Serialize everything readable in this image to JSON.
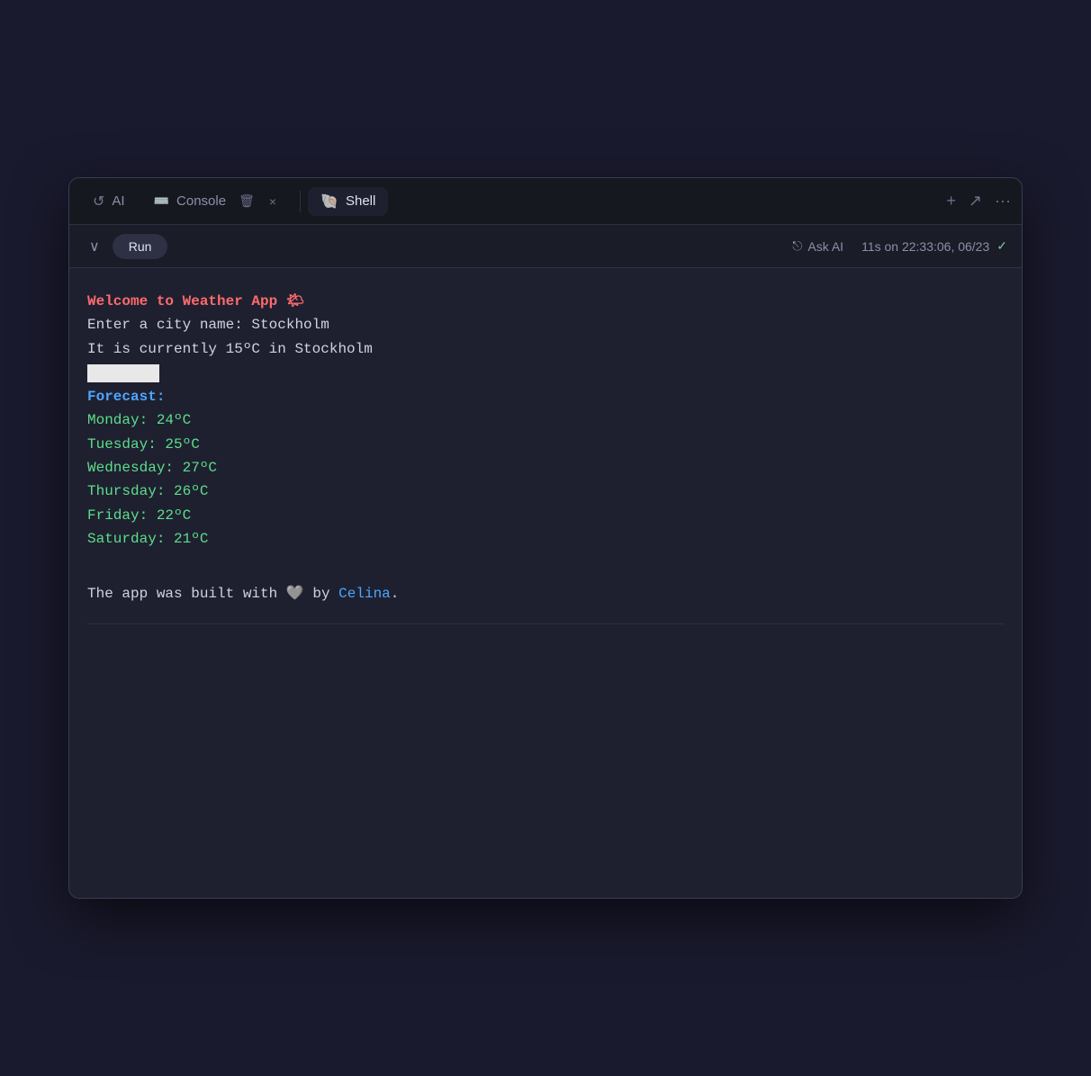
{
  "tabs": [
    {
      "id": "ai",
      "icon": "↺",
      "label": "AI",
      "active": false
    },
    {
      "id": "console",
      "icon": ">_",
      "label": "Console",
      "active": false
    },
    {
      "id": "shell",
      "icon": "🐚",
      "label": "Shell",
      "active": true
    }
  ],
  "tab_actions": {
    "trash": "🗑",
    "close": "×"
  },
  "tab_bar_right": {
    "add": "+",
    "expand": "↗",
    "more": "···"
  },
  "toolbar": {
    "chevron": "∨",
    "run_label": "Run",
    "ask_ai_icon": "⎋",
    "ask_ai_label": "Ask AI",
    "timestamp": "11s on 22:33:06, 06/23",
    "checkmark": "✓"
  },
  "terminal": {
    "welcome": "Welcome to Weather App 🌤",
    "city_prompt": "Enter a city name: Stockholm",
    "current_temp": "It is currently 15ºC in Stockholm",
    "forecast_label": "Forecast:",
    "forecast": [
      {
        "day": "Monday:",
        "temp": "  24ºC"
      },
      {
        "day": "Tuesday:",
        "temp": "  25ºC"
      },
      {
        "day": "Wednesday:",
        "temp": " 27ºC"
      },
      {
        "day": "Thursday:",
        "temp": " 26ºC"
      },
      {
        "day": "Friday:",
        "temp": "   22ºC"
      },
      {
        "day": "Saturday:",
        "temp": " 21ºC"
      }
    ],
    "built_prefix": "The app was built with 🩶 by ",
    "author": "Celina",
    "built_suffix": "."
  }
}
